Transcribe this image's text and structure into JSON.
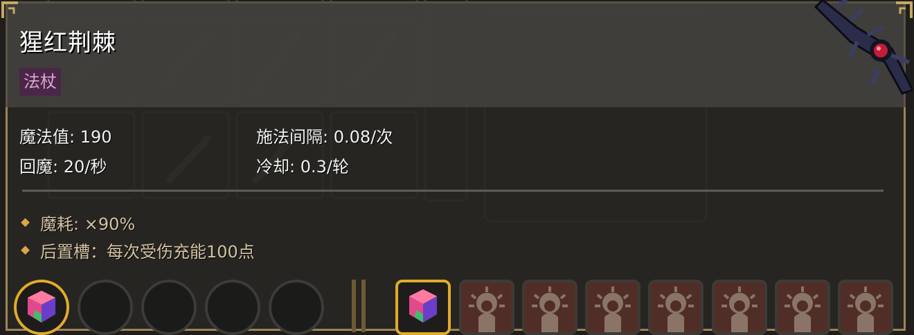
{
  "item": {
    "name": "猩红荆棘",
    "type_tag": "法杖"
  },
  "stats": {
    "mana_label_value": "魔法值: 190",
    "cast_interval": "施法间隔: 0.08/次",
    "mana_regen": "回魔: 20/秒",
    "cooldown": "冷却: 0.3/轮"
  },
  "effects": [
    "魔耗: ×90%",
    "后置槽：每次受伤充能100点"
  ],
  "slots": {
    "round": [
      {
        "icon": "gem-icon",
        "filled": true
      },
      {
        "icon": "",
        "filled": false
      },
      {
        "icon": "",
        "filled": false
      },
      {
        "icon": "",
        "filled": false
      },
      {
        "icon": "",
        "filled": false
      }
    ],
    "square": [
      {
        "icon": "gem-icon",
        "active": true
      },
      {
        "icon": "locked-sun-figure-icon",
        "active": false
      },
      {
        "icon": "locked-sun-figure-icon",
        "active": false
      },
      {
        "icon": "locked-sun-figure-icon",
        "active": false
      },
      {
        "icon": "locked-sun-figure-icon",
        "active": false
      },
      {
        "icon": "locked-sun-figure-icon",
        "active": false
      },
      {
        "icon": "locked-sun-figure-icon",
        "active": false
      },
      {
        "icon": "locked-sun-figure-icon",
        "active": false
      }
    ]
  },
  "colors": {
    "frame": "#9c8456",
    "tag_bg": "#4a2648",
    "tag_text": "#d8a7cf",
    "bullet": "#d9a64a",
    "effect_text": "#d4c3a3",
    "active_slot": "#e2ab2b",
    "locked_slot": "#502e27"
  }
}
